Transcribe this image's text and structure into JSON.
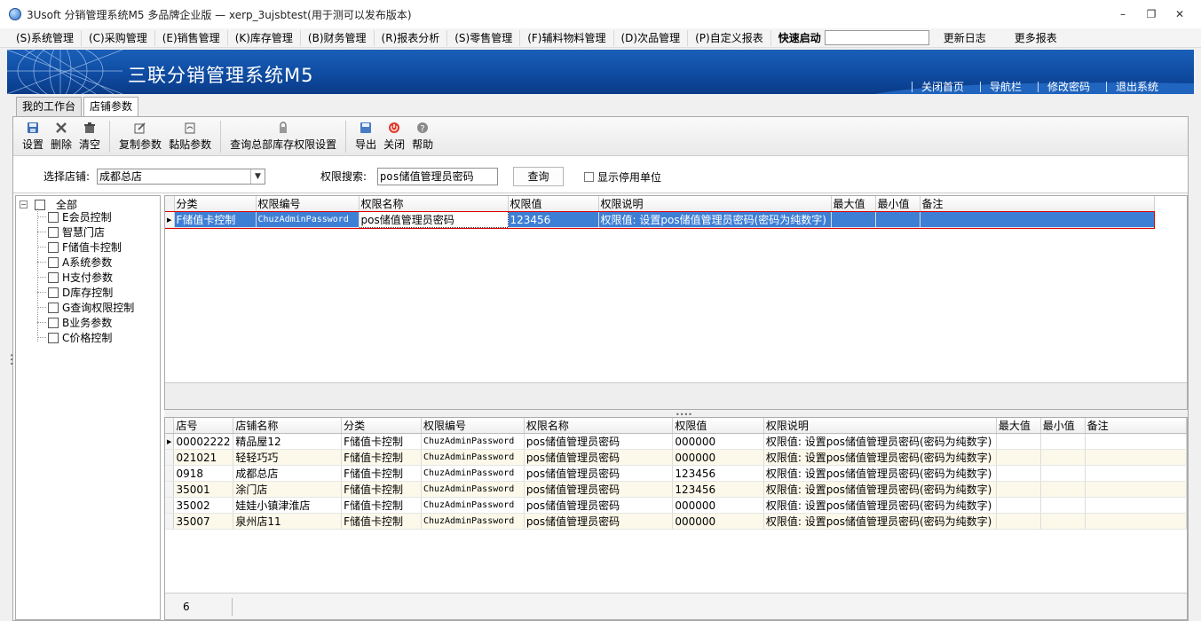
{
  "window": {
    "title": "3Usoft 分销管理系统M5 多品牌企业版 — xerp_3ujsbtest(用于测可以发布版本)"
  },
  "menu": {
    "items": [
      "(S)系统管理",
      "(C)采购管理",
      "(E)销售管理",
      "(K)库存管理",
      "(B)财务管理",
      "(R)报表分析",
      "(S)零售管理",
      "(F)辅料物料管理",
      "(D)次品管理",
      "(P)自定义报表"
    ],
    "quick_start_label": "快速启动",
    "quick_start_value": "",
    "changelog": "更新日志",
    "more_reports": "更多报表"
  },
  "banner": {
    "brand": "三联分销管理系统M5",
    "links": [
      "关闭首页",
      "导航栏",
      "修改密码",
      "退出系统"
    ]
  },
  "tabs": [
    "我的工作台",
    "店铺参数"
  ],
  "toolbar": {
    "buttons": [
      "设置",
      "删除",
      "清空",
      "复制参数",
      "黏贴参数",
      "查询总部库存权限设置",
      "导出",
      "关闭",
      "帮助"
    ]
  },
  "filter": {
    "store_label": "选择店铺:",
    "store_value": "成都总店",
    "search_label": "权限搜索:",
    "search_value": "pos储值管理员密码",
    "query_button": "查询",
    "show_disabled_label": "显示停用单位",
    "show_disabled_checked": false
  },
  "tree": {
    "root": "全部",
    "nodes": [
      "E会员控制",
      "智慧门店",
      "F储值卡控制",
      "A系统参数",
      "H支付参数",
      "D库存控制",
      "G查询权限控制",
      "B业务参数",
      "C价格控制"
    ]
  },
  "top_grid": {
    "headers": [
      "分类",
      "权限编号",
      "权限名称",
      "权限值",
      "权限说明",
      "最大值",
      "最小值",
      "备注"
    ],
    "rows": [
      [
        "F储值卡控制",
        "ChuzAdminPassword",
        "pos储值管理员密码",
        "123456",
        "权限值: 设置pos储值管理员密码(密码为纯数字)",
        "",
        "",
        ""
      ]
    ]
  },
  "bottom_grid": {
    "headers": [
      "店号",
      "店铺名称",
      "分类",
      "权限编号",
      "权限名称",
      "权限值",
      "权限说明",
      "最大值",
      "最小值",
      "备注"
    ],
    "rows": [
      [
        "00002222",
        "精品屋12",
        "F储值卡控制",
        "ChuzAdminPassword",
        "pos储值管理员密码",
        "000000",
        "权限值: 设置pos储值管理员密码(密码为纯数字)",
        "",
        "",
        ""
      ],
      [
        "021021",
        "轻轻巧巧",
        "F储值卡控制",
        "ChuzAdminPassword",
        "pos储值管理员密码",
        "000000",
        "权限值: 设置pos储值管理员密码(密码为纯数字)",
        "",
        "",
        ""
      ],
      [
        "0918",
        "成都总店",
        "F储值卡控制",
        "ChuzAdminPassword",
        "pos储值管理员密码",
        "123456",
        "权限值: 设置pos储值管理员密码(密码为纯数字)",
        "",
        "",
        ""
      ],
      [
        "35001",
        "涂门店",
        "F储值卡控制",
        "ChuzAdminPassword",
        "pos储值管理员密码",
        "123456",
        "权限值: 设置pos储值管理员密码(密码为纯数字)",
        "",
        "",
        ""
      ],
      [
        "35002",
        "娃娃小镇津淮店",
        "F储值卡控制",
        "ChuzAdminPassword",
        "pos储值管理员密码",
        "000000",
        "权限值: 设置pos储值管理员密码(密码为纯数字)",
        "",
        "",
        ""
      ],
      [
        "35007",
        "泉州店11",
        "F储值卡控制",
        "ChuzAdminPassword",
        "pos储值管理员密码",
        "000000",
        "权限值: 设置pos储值管理员密码(密码为纯数字)",
        "",
        "",
        ""
      ]
    ],
    "record_count": "6"
  },
  "colors": {
    "banner_blue": "#0e4aa0",
    "selection_blue": "#3e7fd6",
    "selection_border": "#dd0000",
    "alt_row": "#fcf9ea"
  }
}
